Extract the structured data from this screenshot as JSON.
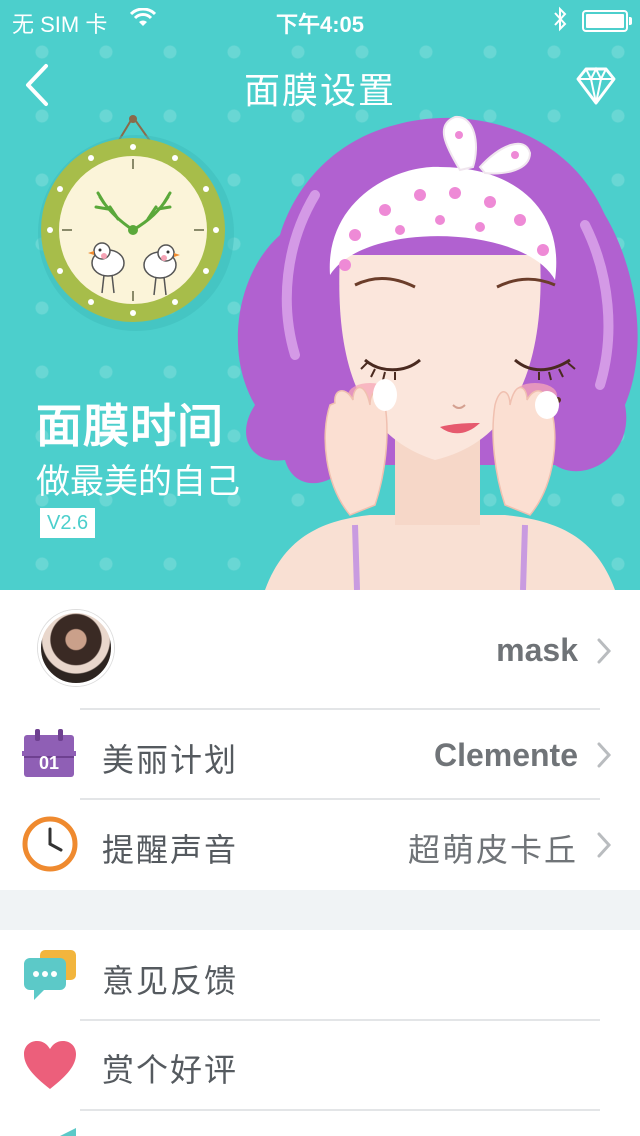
{
  "status_bar": {
    "carrier": "无 SIM 卡",
    "time": "下午4:05"
  },
  "nav": {
    "title": "面膜设置"
  },
  "hero": {
    "title": "面膜时间",
    "subtitle": "做最美的自己",
    "version": "V2.6"
  },
  "colors": {
    "accent": "#4ccfcc",
    "plan_icon": "#8f5fb5",
    "clock_icon": "#ef8a2f",
    "feedback_icon": "#5cc9c8",
    "heart_icon": "#ec5f7b"
  },
  "profile": {
    "name": "mask"
  },
  "settings": {
    "plan": {
      "label": "美丽计划",
      "value": "Clemente",
      "icon_text": "01"
    },
    "sound": {
      "label": "提醒声音",
      "value": "超萌皮卡丘"
    }
  },
  "more": {
    "feedback": {
      "label": "意见反馈"
    },
    "rate": {
      "label": "赏个好评"
    }
  }
}
